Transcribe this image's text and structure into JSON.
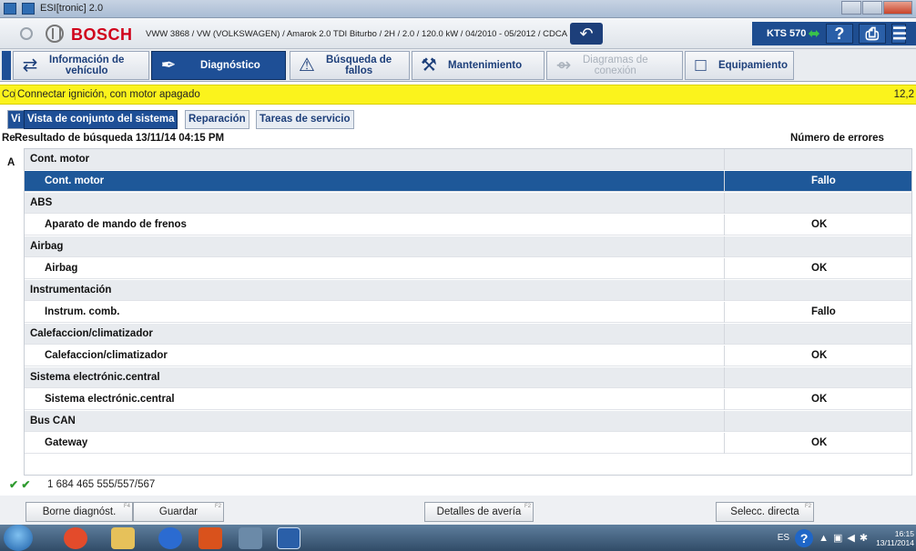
{
  "window": {
    "title": "ESI[tronic] 2.0"
  },
  "header": {
    "brand": "BOSCH",
    "vehicle": "VWW 3868 / VW (VOLKSWAGEN) / Amarok 2.0 TDI Biturbo / 2H / 2.0 / 120.0 kW / 04/2010 - 05/2012 / CDCA",
    "device": "KTS 570",
    "help_label": "?",
    "print_label": "⎙"
  },
  "tabs": [
    {
      "label1": "Información de",
      "label2": "vehículo",
      "icon": "⇄"
    },
    {
      "label1": "Diagnóstico",
      "label2": "",
      "icon": "✒"
    },
    {
      "label1": "Búsqueda de",
      "label2": "fallos",
      "icon": "⚠"
    },
    {
      "label1": "Mantenimiento",
      "label2": "",
      "icon": "⚒"
    },
    {
      "label1": "Diagramas de",
      "label2": "conexión",
      "icon": "⇴"
    },
    {
      "label1": "Equipamiento",
      "label2": "",
      "icon": "□"
    }
  ],
  "status": {
    "prefix": "Co",
    "message": "Connectar ignición, con motor apagado",
    "voltage": "12,2"
  },
  "subtabs": {
    "stub": "Vi",
    "items": [
      "Vista de conjunto del sistema",
      "Reparación",
      "Tareas de servicio"
    ]
  },
  "results": {
    "prefix": "Re",
    "title": "Resultado de búsqueda  13/11/14  04:15 PM",
    "errors_header": "Número de errores",
    "side_letter": "A"
  },
  "rows": [
    {
      "type": "group",
      "name": "Cont. motor",
      "status": ""
    },
    {
      "type": "item",
      "name": "Cont. motor",
      "status": "Fallo",
      "selected": true
    },
    {
      "type": "group",
      "name": "ABS",
      "status": ""
    },
    {
      "type": "item",
      "name": "Aparato de mando de frenos",
      "status": "OK"
    },
    {
      "type": "group",
      "name": "Airbag",
      "status": ""
    },
    {
      "type": "item",
      "name": "Airbag",
      "status": "OK"
    },
    {
      "type": "group",
      "name": "Instrumentación",
      "status": ""
    },
    {
      "type": "item",
      "name": "Instrum. comb.",
      "status": "Fallo"
    },
    {
      "type": "group",
      "name": "Calefaccion/climatizador",
      "status": ""
    },
    {
      "type": "item",
      "name": "Calefaccion/climatizador",
      "status": "OK"
    },
    {
      "type": "group",
      "name": "Sistema electrónic.central",
      "status": ""
    },
    {
      "type": "item",
      "name": "Sistema electrónic.central",
      "status": "OK"
    },
    {
      "type": "group",
      "name": "Bus CAN",
      "status": ""
    },
    {
      "type": "item",
      "name": "Gateway",
      "status": "OK"
    }
  ],
  "footer": {
    "checks": "✔ ✔",
    "part_number": "1 684 465 555/557/567",
    "buttons": [
      {
        "label": "Borne diagnóst.",
        "key": "F4"
      },
      {
        "label": "Guardar",
        "key": "F2"
      },
      {
        "label": "Detalles de avería",
        "key": "F2"
      },
      {
        "label": "Selecc. directa",
        "key": "F2"
      }
    ]
  },
  "taskbar": {
    "lang": "ES",
    "help": "?",
    "time": "16:15",
    "date": "13/11/2014"
  }
}
